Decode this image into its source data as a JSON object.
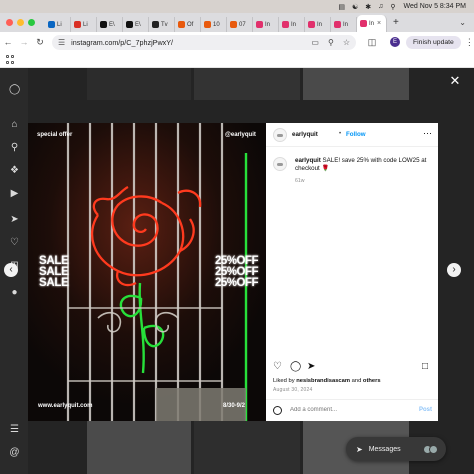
{
  "menubar": {
    "date_time": "Wed Nov 5  8:34 PM",
    "icons": [
      "control-center-icon",
      "wifi-icon",
      "bluetooth-icon",
      "sound-icon",
      "search-icon"
    ]
  },
  "tabs": [
    {
      "label": "Li",
      "icon": "linkedin",
      "color": "#0a66c2"
    },
    {
      "label": "Li",
      "icon": "gmail",
      "color": "#d93025"
    },
    {
      "label": "E\\",
      "icon": "x",
      "color": "#111111"
    },
    {
      "label": "E\\",
      "icon": "x",
      "color": "#111111"
    },
    {
      "label": "Tv",
      "icon": "threads",
      "color": "#222222"
    },
    {
      "label": "Of",
      "icon": "app",
      "color": "#e8590c"
    },
    {
      "label": "10",
      "icon": "app",
      "color": "#e8590c"
    },
    {
      "label": "07",
      "icon": "app",
      "color": "#e8590c"
    },
    {
      "label": "In",
      "icon": "instagram",
      "color": "#e1306c"
    },
    {
      "label": "In",
      "icon": "instagram",
      "color": "#e1306c"
    },
    {
      "label": "In",
      "icon": "instagram",
      "color": "#e1306c"
    },
    {
      "label": "In",
      "icon": "instagram",
      "color": "#e1306c"
    },
    {
      "label": "In",
      "icon": "instagram",
      "color": "#e1306c"
    }
  ],
  "address_bar": {
    "url": "instagram.com/p/C_7phzjPwxY/",
    "finish_update": "Finish update",
    "profile_initial": "E"
  },
  "post": {
    "image_text": {
      "top_left": "special offer",
      "top_right": "@earlyquit",
      "sale_lines": [
        "SALE",
        "SALE",
        "SALE"
      ],
      "off_lines": [
        "25%OFF",
        "25%OFF",
        "25%OFF"
      ],
      "bottom_left": "www.earlyquit.com",
      "bottom_right": "8/30-9/2"
    },
    "username": "earlyquit",
    "dot": "•",
    "follow": "Follow",
    "caption_username": "earlyquit",
    "caption_text": " SALE! save 25% with code LOW25 at checkout 🌹",
    "caption_time": "61w",
    "liked_by_prefix": "Liked by ",
    "liked_by_user": "nesisbrandisascam",
    "liked_by_and": " and ",
    "liked_by_others": "others",
    "date": "August 30, 2024",
    "comment_placeholder": "Add a comment...",
    "post_label": "Post"
  },
  "messages": {
    "label": "Messages"
  }
}
